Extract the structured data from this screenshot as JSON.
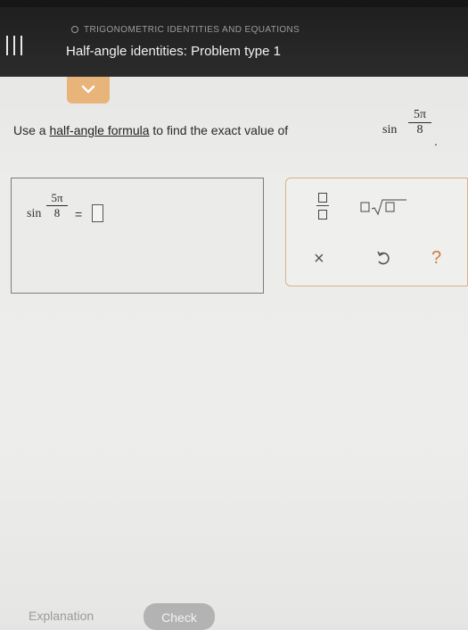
{
  "header": {
    "topic": "TRIGONOMETRIC IDENTITIES AND EQUATIONS",
    "title": "Half-angle identities: Problem type 1"
  },
  "question": {
    "prefix": "Use a ",
    "link": "half-angle formula",
    "suffix": " to find the exact value of",
    "func": "sin",
    "numerator": "5π",
    "denominator": "8",
    "period": "."
  },
  "answer": {
    "func": "sin",
    "numerator": "5π",
    "denominator": "8",
    "equals": "="
  },
  "tools": {
    "clear": "×",
    "help": "?"
  },
  "footer": {
    "explanation": "Explanation",
    "check": "Check"
  },
  "colors": {
    "header_bg": "#2b2b2b",
    "accent": "#e9b47a",
    "help": "#d07a3c",
    "check_btn": "#b3b3b3"
  }
}
